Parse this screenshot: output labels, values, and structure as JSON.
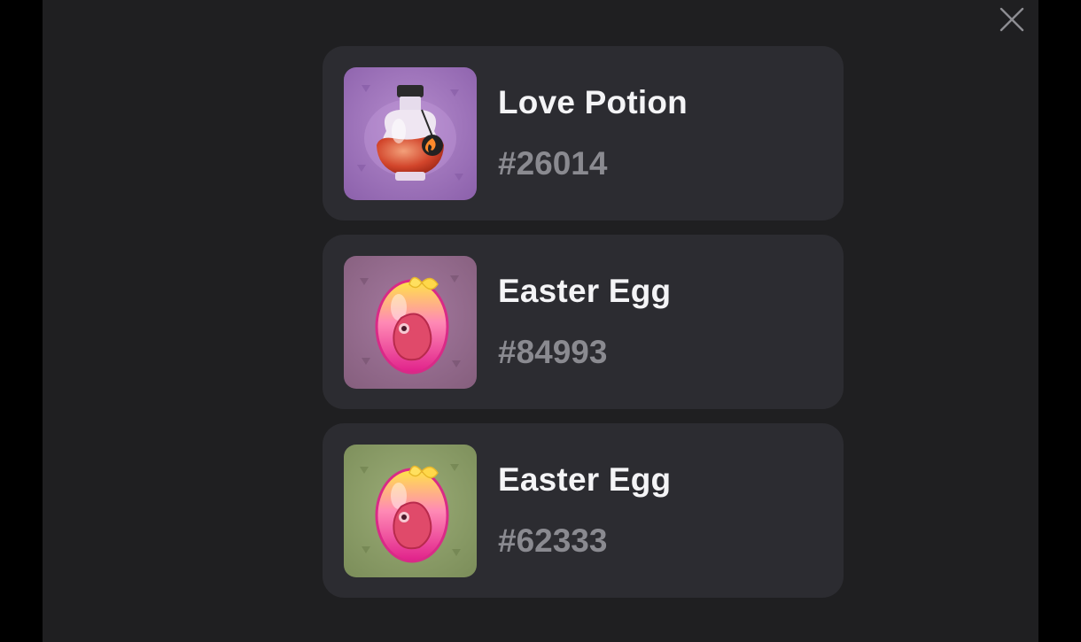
{
  "close": {
    "icon": "close-icon"
  },
  "items": [
    {
      "name": "Love Potion",
      "number": "#26014",
      "icon": "love-potion-icon",
      "bg": "#9b71b8"
    },
    {
      "name": "Easter Egg",
      "number": "#84993",
      "icon": "easter-egg-icon",
      "bg": "#93688e"
    },
    {
      "name": "Easter Egg",
      "number": "#62333",
      "icon": "easter-egg-icon",
      "bg": "#8a9c68"
    }
  ],
  "colors": {
    "background": "#000000",
    "modal": "#1f1f21",
    "card": "#2c2c31",
    "title": "#f4f4f6",
    "subtitle": "#8a8a90"
  }
}
